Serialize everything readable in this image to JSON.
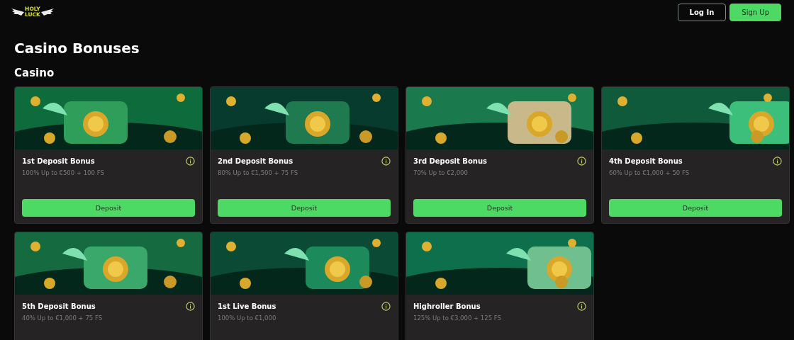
{
  "header": {
    "logo": [
      "HOLY",
      "LUCK"
    ],
    "buttons": [
      {
        "label": "Log In",
        "kind": "outline"
      },
      {
        "label": "Sign Up",
        "kind": "primary"
      }
    ]
  },
  "title": "Casino Bonuses",
  "section": "Casino",
  "cards": [
    {
      "kind": "picture",
      "title": "1st Deposit Bonus",
      "offer": "100% Up to €500 + 100 FS",
      "button": "Deposit"
    },
    {
      "kind": "picture",
      "title": "2nd Deposit Bonus",
      "offer": "80% Up to €1,500 + 75 FS",
      "button": "Deposit"
    },
    {
      "kind": "picture",
      "title": "3rd Deposit Bonus",
      "offer": "70% Up to €2,000",
      "button": "Deposit"
    },
    {
      "kind": "picture",
      "title": "4th Deposit Bonus",
      "offer": "60% Up to €1,000 + 50 FS",
      "button": "Deposit"
    },
    {
      "kind": "picture",
      "title": "5th Deposit Bonus",
      "offer": "40% Up to €1,000 + 75 FS"
    },
    {
      "kind": "picture",
      "title": "1st Live Bonus",
      "offer": "100% Up to €1,000"
    },
    {
      "kind": "picture",
      "title": "Highroller Bonus",
      "offer": "125% Up to €3,000 + 125 FS"
    }
  ]
}
